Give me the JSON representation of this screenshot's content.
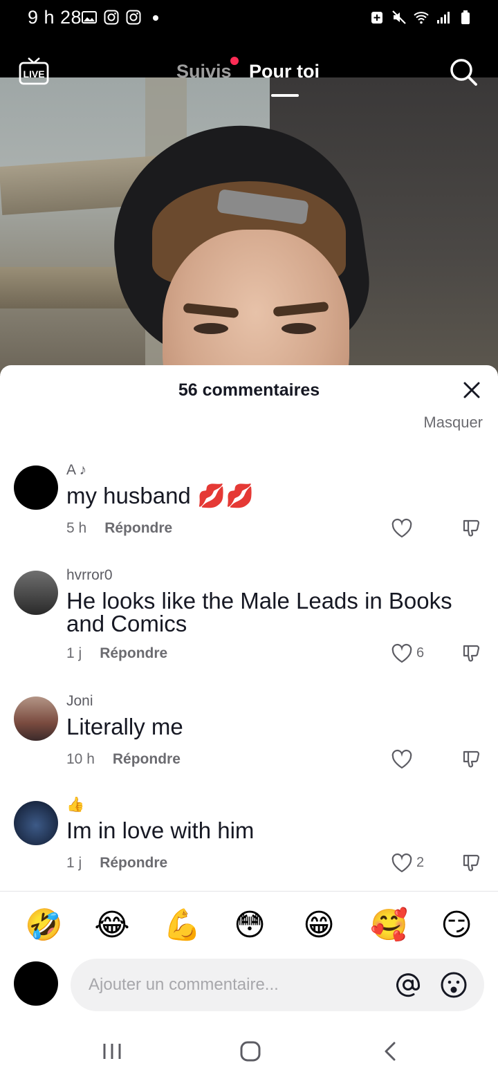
{
  "status_bar": {
    "time": "9 h 28",
    "left_icons": [
      "gallery-icon",
      "instagram-icon",
      "instagram-icon",
      "dot-icon"
    ],
    "right_icons": [
      "battery-saver-icon",
      "mute-icon",
      "wifi-icon",
      "signal-icon",
      "battery-icon"
    ]
  },
  "top_nav": {
    "live_label": "LIVE",
    "tab_following": "Suivis",
    "tab_for_you": "Pour toi",
    "notification_color": "#fe2c55"
  },
  "comments": {
    "title": "56 commentaires",
    "hide_label": "Masquer",
    "items": [
      {
        "user": "A ♪",
        "text": "my husband 💋💋",
        "time": "5 h",
        "reply_label": "Répondre",
        "likes": ""
      },
      {
        "user": "hvrror0",
        "text": "He looks like the Male Leads in Books and Comics",
        "time": "1 j",
        "reply_label": "Répondre",
        "likes": "6"
      },
      {
        "user": "Joni",
        "text": "Literally me",
        "time": "10 h",
        "reply_label": "Répondre",
        "likes": ""
      },
      {
        "user": "👍",
        "text": "Im in love with him",
        "time": "1 j",
        "reply_label": "Répondre",
        "likes": "2"
      }
    ]
  },
  "quick_emojis": [
    "🤣",
    "😂",
    "💪",
    "😳",
    "😁",
    "🥰",
    "😏"
  ],
  "composer": {
    "placeholder": "Ajouter un commentaire..."
  },
  "colors": {
    "accent": "#fe2c55",
    "text_primary": "#161823",
    "text_secondary": "#6b6b70"
  }
}
